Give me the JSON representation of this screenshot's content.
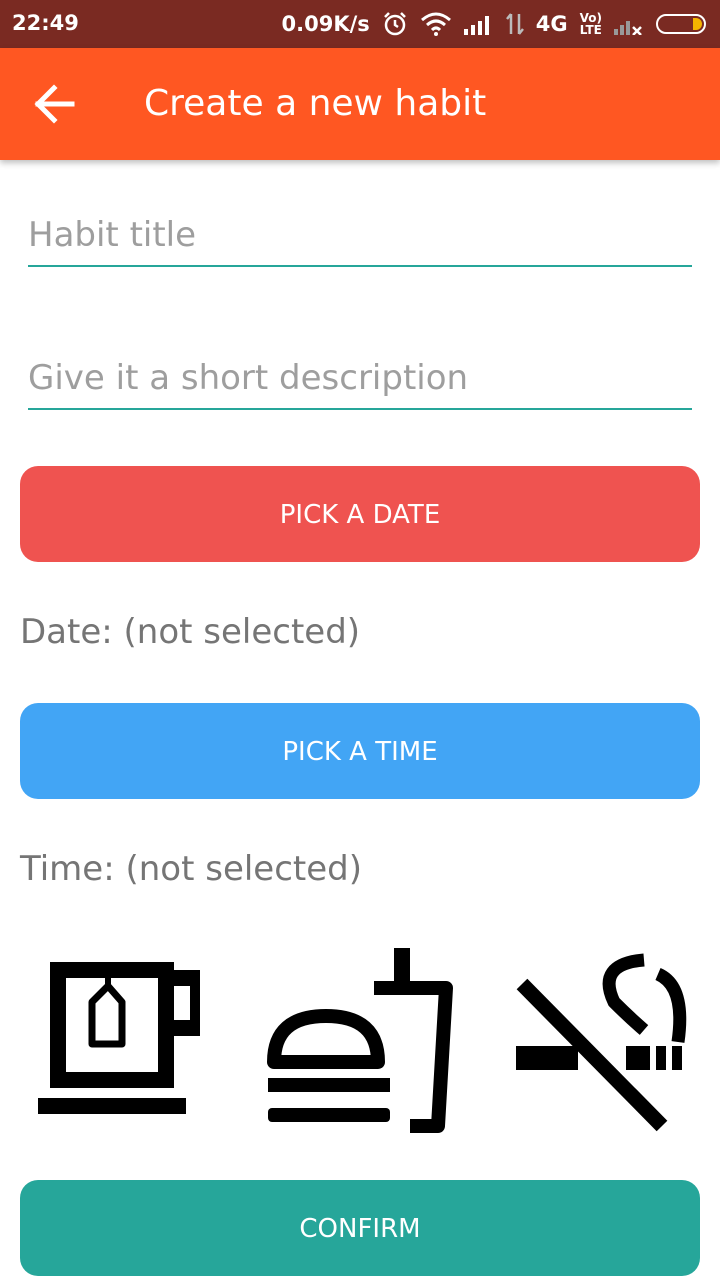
{
  "status_bar": {
    "time": "22:49",
    "speed": "0.09K/s",
    "network": "4G",
    "volte": [
      "Vo)",
      "LTE"
    ]
  },
  "app_bar": {
    "back_icon": "arrow-back",
    "title": "Create a new habit",
    "color": "#ff5722"
  },
  "form": {
    "title_placeholder": "Habit title",
    "description_placeholder": "Give it a short description",
    "pick_date_label": "PICK A DATE",
    "date_status": "Date: (not selected)",
    "pick_time_label": "PICK A TIME",
    "time_status": "Time: (not selected)",
    "confirm_label": "CONFIRM"
  },
  "colors": {
    "pick_date": "#ef5350",
    "pick_time": "#42a5f5",
    "confirm": "#26a69a",
    "underline": "#26a69a"
  },
  "habit_icons": [
    "tea-cup-icon",
    "fast-food-icon",
    "no-smoking-icon"
  ]
}
